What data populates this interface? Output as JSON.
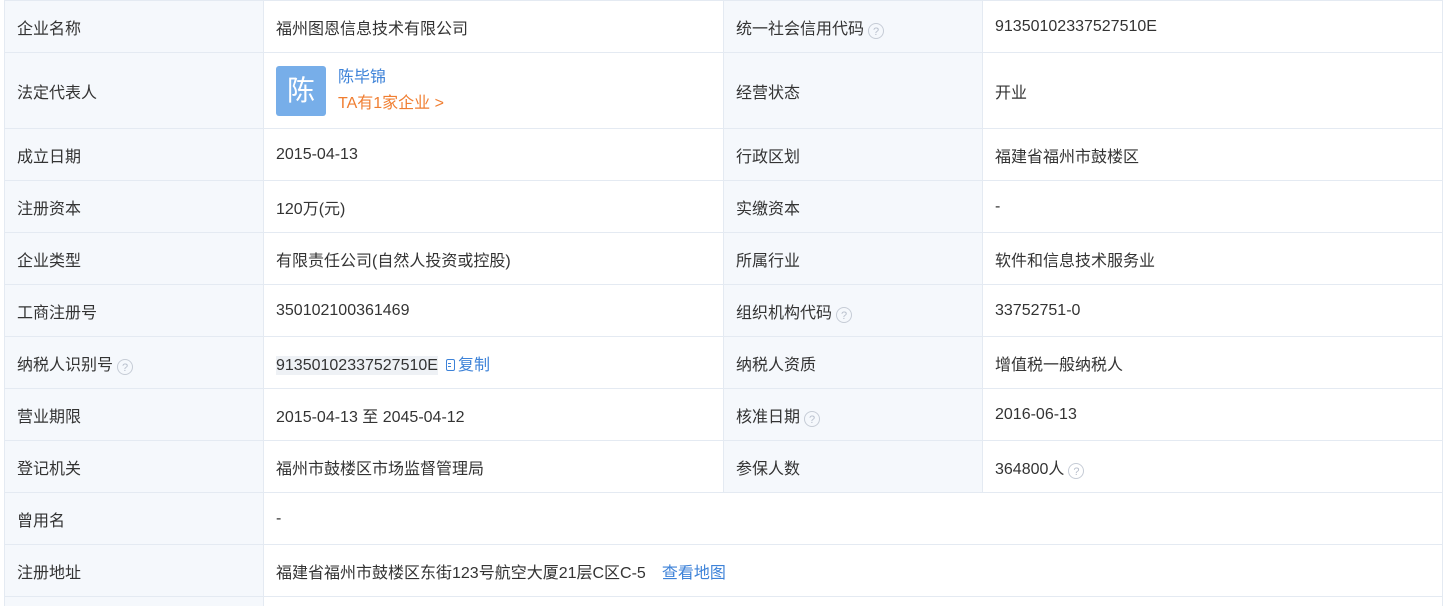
{
  "rows": {
    "company_name": {
      "label": "企业名称",
      "value": "福州图恩信息技术有限公司"
    },
    "credit_code": {
      "label": "统一社会信用代码",
      "value": "91350102337527510E"
    },
    "legal_rep": {
      "label": "法定代表人",
      "avatar_char": "陈",
      "name": "陈毕锦",
      "company_count": "TA有1家企业 >"
    },
    "status": {
      "label": "经营状态",
      "value": "开业"
    },
    "founded": {
      "label": "成立日期",
      "value": "2015-04-13"
    },
    "region": {
      "label": "行政区划",
      "value": "福建省福州市鼓楼区"
    },
    "reg_capital": {
      "label": "注册资本",
      "value": "120万(元)"
    },
    "paid_capital": {
      "label": "实缴资本",
      "value": "-"
    },
    "company_type": {
      "label": "企业类型",
      "value": "有限责任公司(自然人投资或控股)"
    },
    "industry": {
      "label": "所属行业",
      "value": "软件和信息技术服务业"
    },
    "biz_reg_no": {
      "label": "工商注册号",
      "value": "350102100361469"
    },
    "org_code": {
      "label": "组织机构代码",
      "value": "33752751-0"
    },
    "taxpayer_id": {
      "label": "纳税人识别号",
      "value": "91350102337527510E",
      "copy_label": "复制"
    },
    "taxpayer_qual": {
      "label": "纳税人资质",
      "value": "增值税一般纳税人"
    },
    "biz_term": {
      "label": "营业期限",
      "value": "2015-04-13 至 2045-04-12"
    },
    "approval_date": {
      "label": "核准日期",
      "value": "2016-06-13"
    },
    "reg_authority": {
      "label": "登记机关",
      "value": "福州市鼓楼区市场监督管理局"
    },
    "insured": {
      "label": "参保人数",
      "value": "364800人"
    },
    "former_name": {
      "label": "曾用名",
      "value": "-"
    },
    "address": {
      "label": "注册地址",
      "value": "福建省福州市鼓楼区东街123号航空大厦21层C区C-5",
      "map_label": "查看地图"
    }
  },
  "icons": {
    "help": "?",
    "avatar_color": "#77aee9",
    "link_color": "#3d82d8",
    "accent_orange": "#f07e31"
  }
}
